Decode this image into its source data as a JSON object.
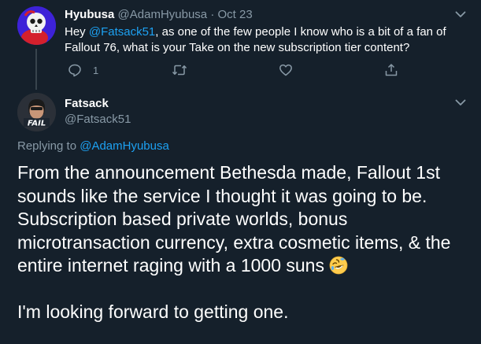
{
  "tweet1": {
    "name": "Hyubusa",
    "handle": "@AdamHyubusa",
    "separator": " · ",
    "date": "Oct 23",
    "text_prefix": "Hey ",
    "mention": "@Fatsack51",
    "text_suffix": ", as one of the few people I know who is a bit of a fan of Fallout 76, what is your Take on the new subscription tier content?",
    "reply_count": "1",
    "icons": [
      "reply-icon",
      "retweet-icon",
      "like-icon",
      "share-icon",
      "chevron-down-icon"
    ]
  },
  "tweet2": {
    "name": "Fatsack",
    "handle": "@Fatsack51",
    "avatar_badge": "FAIL",
    "replying_prefix": "Replying to ",
    "replying_mention": "@AdamHyubusa",
    "paragraph1": "From the announcement Bethesda made, Fallout 1st sounds  like the service I thought it was going to be. Subscription based private worlds, bonus microtransaction currency, extra cosmetic items, & the entire internet raging with a 1000 suns",
    "emoji": "rolling-on-floor-laughing",
    "paragraph2": "I'm looking forward to getting one."
  },
  "colors": {
    "background": "#15202b",
    "text": "#ffffff",
    "secondary": "#8899a6",
    "accent": "#1da1f2",
    "thread_line": "#38444d"
  }
}
